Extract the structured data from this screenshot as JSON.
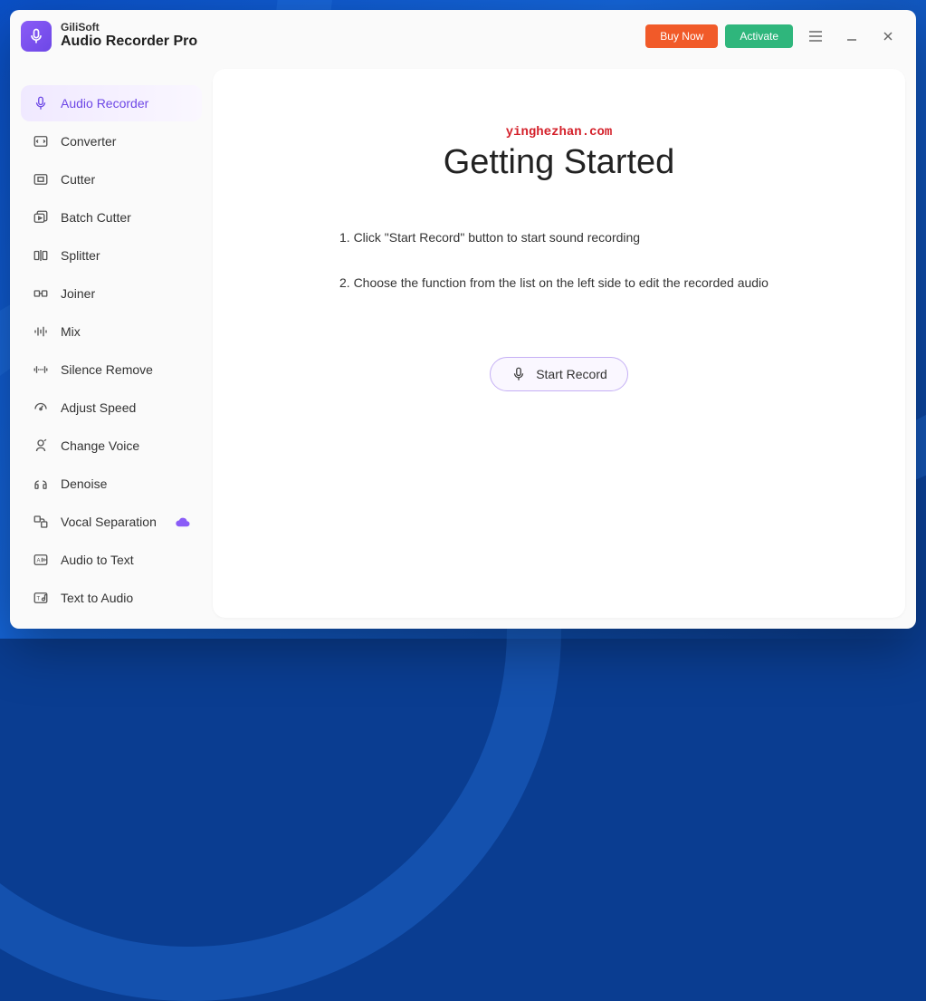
{
  "brand": {
    "top": "GiliSoft",
    "bottom": "Audio Recorder Pro"
  },
  "titlebar": {
    "buy": "Buy Now",
    "activate": "Activate"
  },
  "sidebar": {
    "items": [
      {
        "label": "Audio Recorder",
        "icon": "mic",
        "active": true
      },
      {
        "label": "Converter",
        "icon": "converter"
      },
      {
        "label": "Cutter",
        "icon": "cutter"
      },
      {
        "label": "Batch Cutter",
        "icon": "batch-cutter"
      },
      {
        "label": "Splitter",
        "icon": "splitter"
      },
      {
        "label": "Joiner",
        "icon": "joiner"
      },
      {
        "label": "Mix",
        "icon": "mix"
      },
      {
        "label": "Silence Remove",
        "icon": "silence"
      },
      {
        "label": "Adjust Speed",
        "icon": "speed"
      },
      {
        "label": "Change Voice",
        "icon": "voice"
      },
      {
        "label": "Denoise",
        "icon": "denoise"
      },
      {
        "label": "Vocal Separation",
        "icon": "vocal",
        "cloud": true
      },
      {
        "label": "Audio to Text",
        "icon": "att"
      },
      {
        "label": "Text to Audio",
        "icon": "tta"
      }
    ]
  },
  "main": {
    "watermark": "yinghezhan.com",
    "title": "Getting Started",
    "step1": "1. Click \"Start Record\" button to start sound recording",
    "step2": "2. Choose the function from the list on the left side to edit the recorded audio",
    "start_record": "Start Record"
  }
}
